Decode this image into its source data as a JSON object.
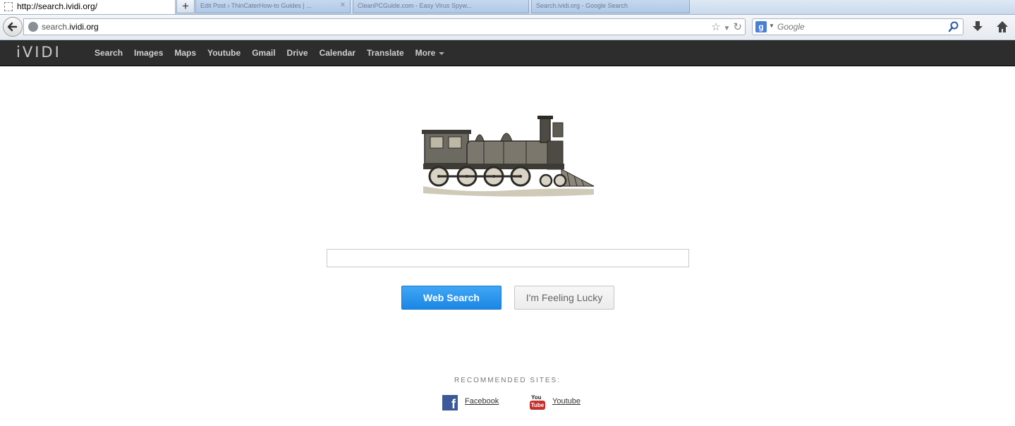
{
  "browser": {
    "active_tab_title": "http://search.ividi.org/",
    "new_tab_label": "+",
    "background_tabs": [
      {
        "title": "Edit Post › ThinCaterHow-to Guides | ..."
      },
      {
        "title": "CleanPCGuide.com - Easy Virus Spyw..."
      },
      {
        "title": "Search.ividi.org - Google Search"
      }
    ],
    "url_prefix": "search.",
    "url_domain": "ividi.org",
    "search_engine_letter": "g",
    "search_placeholder": "Google"
  },
  "site": {
    "logo": "iVIDI",
    "menu": [
      "Search",
      "Images",
      "Maps",
      "Youtube",
      "Gmail",
      "Drive",
      "Calendar",
      "Translate"
    ],
    "more_label": "More"
  },
  "main": {
    "search_value": "",
    "web_search_label": "Web Search",
    "lucky_label": "I'm Feeling Lucky",
    "recommended_label": "RECOMMENDED SITES:",
    "sites": [
      {
        "name": "Facebook",
        "icon": "facebook-icon"
      },
      {
        "name": "Youtube",
        "icon": "youtube-icon"
      }
    ]
  },
  "colors": {
    "topbar": "#2d2d2d",
    "web_search_button": "#2196f0",
    "facebook": "#3b5998",
    "youtube": "#c4302b"
  }
}
